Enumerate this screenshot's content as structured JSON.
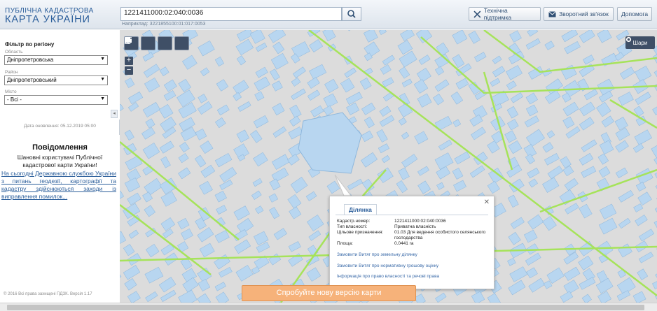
{
  "header": {
    "logo_line1": "ПУБЛІЧНА КАДАСТРОВА",
    "logo_line2": "КАРТА УКРАЇНИ",
    "search_value": "1221411000:02:040:0036",
    "search_hint": "Наприклад: 3221855100:01:017:0053",
    "buttons": {
      "support": "Технічна підтримка",
      "feedback": "Зворотний зв'язок",
      "help": "Допомога"
    }
  },
  "filter": {
    "title": "Фільтр по регіону",
    "region_label": "Область",
    "region_value": "Дніпропетровська",
    "district_label": "Район",
    "district_value": "Дніпропетровський",
    "city_label": "Місто",
    "city_value": "- Всі -",
    "update_date": "Дата оновлення: 05.12.2019 05:00"
  },
  "notice": {
    "title": "Повідомлення",
    "subtitle": "Шановні користувачі Публічної кадастрової карти України!",
    "link_text": "На сьогодні Державною службою України з питань геодезії, картографії та кадастру здійснюються заходи із виправлення помилок..."
  },
  "copyright": "© 2016 Всі права захищені ПДЗК. Версія 1.17",
  "map": {
    "layers_label": "Шари",
    "parcel_color": "#b8d6f0",
    "road_color": "#a6e35a",
    "popup": {
      "tab": "Ділянка",
      "rows": [
        {
          "k": "Кадастр.номер:",
          "v": "1221411000:02:040:0036"
        },
        {
          "k": "Тип власності:",
          "v": "Приватна власність"
        },
        {
          "k": "Цільове призначення:",
          "v": "01.03 Для ведення особистого селянського господарства"
        },
        {
          "k": "Площа:",
          "v": "0.0441 га"
        }
      ],
      "links": [
        "Замовити Витяг про земельну ділянку",
        "Замовити Витяг про нормативну грошову оцінку",
        "Інформація про право власності та речові права"
      ]
    }
  },
  "promo": "Спробуйте нову версію карти"
}
